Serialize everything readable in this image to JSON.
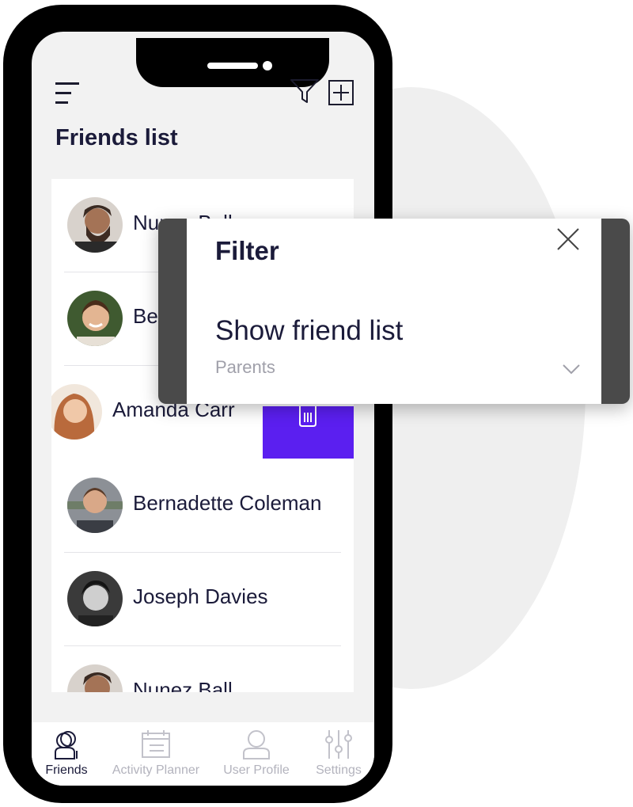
{
  "header": {
    "title": "Friends list",
    "icons": {
      "menu": "hamburger-icon",
      "filter": "filter-icon",
      "add": "add-square-icon"
    }
  },
  "friends": [
    {
      "name": "Nunez Ball",
      "avatar": "avatar-bearded-man"
    },
    {
      "name": "Belinda",
      "avatar": "avatar-smiling-boy"
    },
    {
      "name": "Amanda Carr",
      "avatar": "avatar-red-haired-woman"
    },
    {
      "name": "Bernadette Coleman",
      "avatar": "avatar-young-man"
    },
    {
      "name": "Joseph Davies",
      "avatar": "avatar-dark-haired-man"
    },
    {
      "name": "Nunez Ball",
      "avatar": "avatar-bearded-man"
    }
  ],
  "swipe_action": {
    "icon": "trash-icon",
    "color": "#5b1ff0"
  },
  "tabs": [
    {
      "label": "Friends",
      "icon": "friends-icon",
      "active": true
    },
    {
      "label": "Activity Planner",
      "icon": "calendar-icon",
      "active": false
    },
    {
      "label": "User Profile",
      "icon": "user-icon",
      "active": false
    },
    {
      "label": "Settings",
      "icon": "sliders-icon",
      "active": false
    }
  ],
  "filter_modal": {
    "title": "Filter",
    "close_icon": "close-icon",
    "field_label": "Show friend list",
    "selected_value": "Parents",
    "dropdown_icon": "chevron-down-icon"
  },
  "colors": {
    "text_dark": "#1b1b3a",
    "accent": "#5b1ff0",
    "muted": "#b3b3bd",
    "modal_side": "#4a4a4a"
  }
}
